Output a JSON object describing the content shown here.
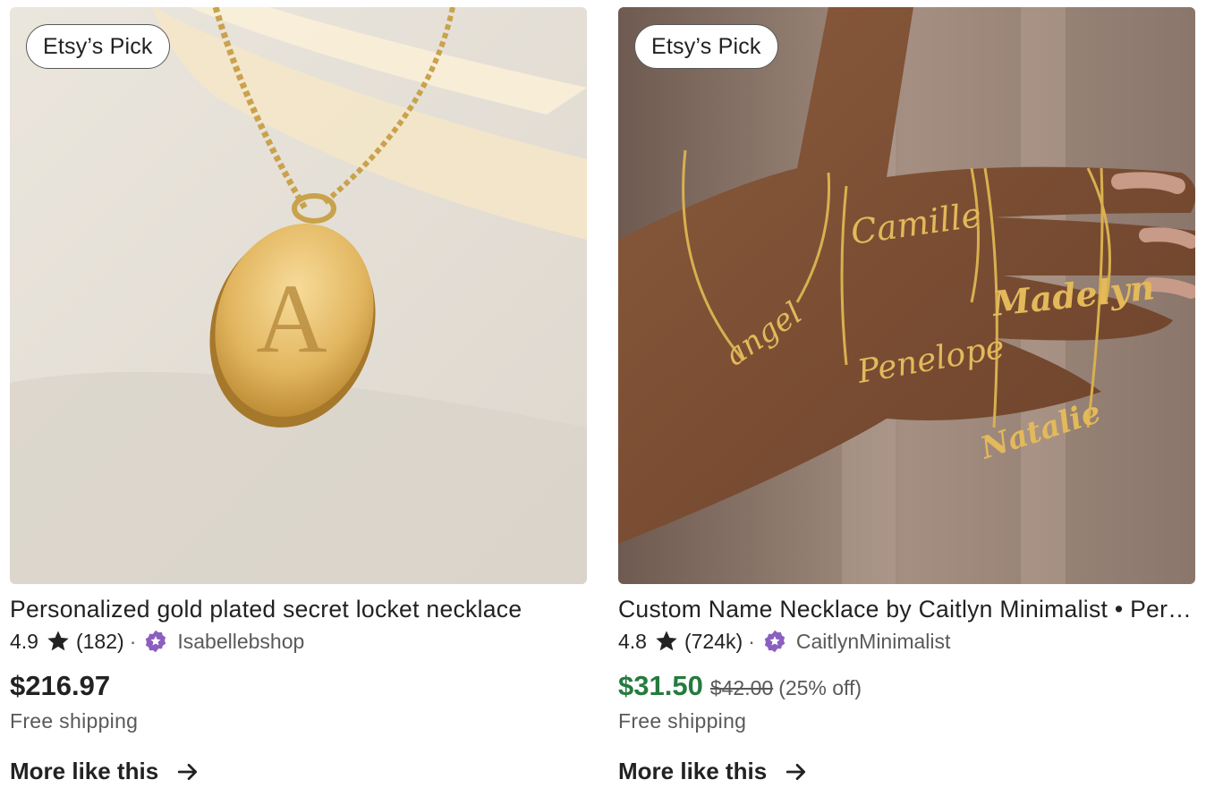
{
  "colors": {
    "sale_price": "#257b3f",
    "star_seller": "#8b5fbf",
    "text_primary": "#222222",
    "text_secondary": "#595959"
  },
  "listings": [
    {
      "badge": "Etsy’s Pick",
      "title": "Personalized gold plated secret locket necklace",
      "rating": "4.9",
      "review_count": "(182)",
      "separator": "·",
      "shop": "Isabellebshop",
      "price": "$216.97",
      "original_price": "",
      "discount": "",
      "shipping": "Free shipping",
      "more_label": "More like this",
      "image_text": "A"
    },
    {
      "badge": "Etsy’s Pick",
      "title": "Custom Name Necklace by Caitlyn Minimalist • Personalized",
      "rating": "4.8",
      "review_count": "(724k)",
      "separator": "·",
      "shop": "CaitlynMinimalist",
      "price": "$31.50",
      "original_price": "$42.00",
      "discount": "(25% off)",
      "shipping": "Free shipping",
      "more_label": "More like this",
      "image_names": [
        "Camille",
        "angel",
        "Madelyn",
        "Penelope",
        "Natalie"
      ]
    }
  ],
  "icons": {
    "rating": "star-icon",
    "seller": "star-seller-icon",
    "more": "arrow-right-icon"
  }
}
